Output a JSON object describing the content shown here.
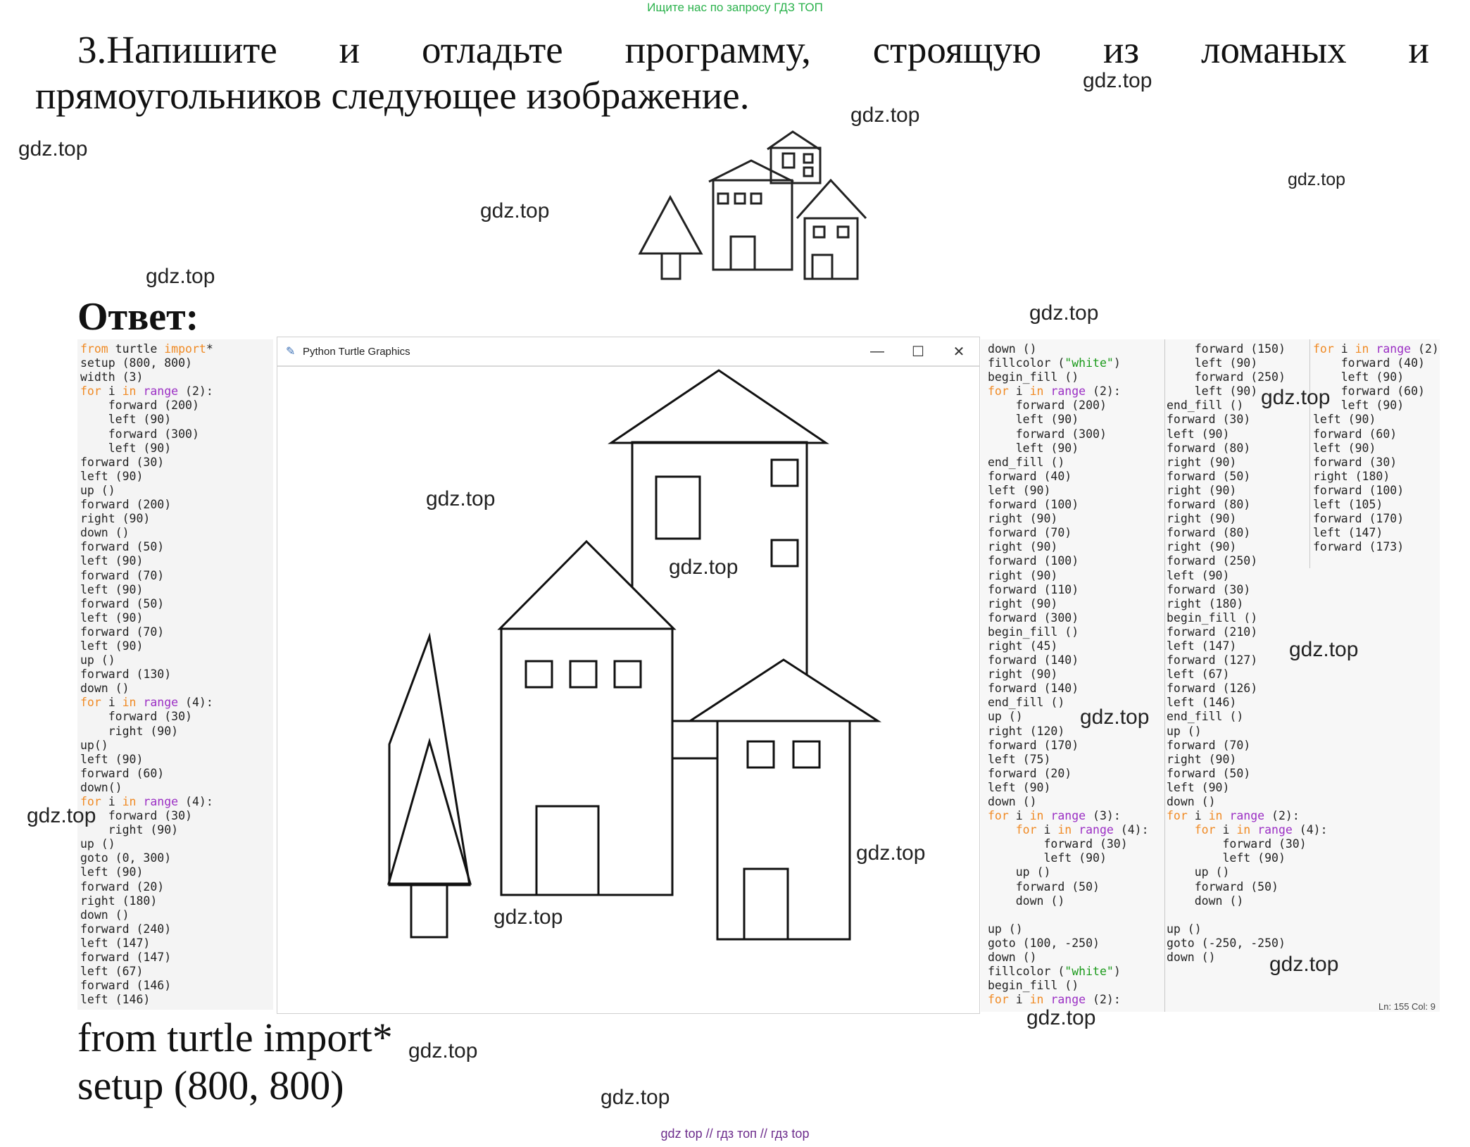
{
  "banner": "Ищите нас по запросу ГДЗ ТОП",
  "task": {
    "line1": [
      "3.Напишите",
      "и",
      "отладьте",
      "программу,",
      "строящую",
      "из",
      "ломаных",
      "и"
    ],
    "line2": "прямоугольников следующее изображение."
  },
  "answer_label": "Ответ:",
  "watermark": "gdz.top",
  "window": {
    "title": "Python Turtle Graphics",
    "minimize": "—",
    "maximize": "☐",
    "close": "✕"
  },
  "code_left": [
    "from turtle import*",
    "setup (800, 800)",
    "width (3)",
    "for i in range (2):",
    "    forward (200)",
    "    left (90)",
    "    forward (300)",
    "    left (90)",
    "forward (30)",
    "left (90)",
    "up ()",
    "forward (200)",
    "right (90)",
    "down ()",
    "forward (50)",
    "left (90)",
    "forward (70)",
    "left (90)",
    "forward (50)",
    "left (90)",
    "forward (70)",
    "left (90)",
    "up ()",
    "forward (130)",
    "down ()",
    "for i in range (4):",
    "    forward (30)",
    "    right (90)",
    "up()",
    "left (90)",
    "forward (60)",
    "down()",
    "for i in range (4):",
    "    forward (30)",
    "    right (90)",
    "up ()",
    "goto (0, 300)",
    "left (90)",
    "forward (20)",
    "right (180)",
    "down ()",
    "forward (240)",
    "left (147)",
    "forward (147)",
    "left (67)",
    "forward (146)",
    "left (146)"
  ],
  "code_right1": [
    "down ()",
    "fillcolor (\"white\")",
    "begin_fill ()",
    "for i in range (2):",
    "    forward (200)",
    "    left (90)",
    "    forward (300)",
    "    left (90)",
    "end_fill ()",
    "forward (40)",
    "left (90)",
    "forward (100)",
    "right (90)",
    "forward (70)",
    "right (90)",
    "forward (100)",
    "right (90)",
    "forward (110)",
    "right (90)",
    "forward (300)",
    "begin_fill ()",
    "right (45)",
    "forward (140)",
    "right (90)",
    "forward (140)",
    "end_fill ()",
    "up ()",
    "right (120)",
    "forward (170)",
    "left (75)",
    "forward (20)",
    "left (90)",
    "down ()",
    "for i in range (3):",
    "    for i in range (4):",
    "        forward (30)",
    "        left (90)",
    "    up ()",
    "    forward (50)",
    "    down ()",
    "",
    "up ()",
    "goto (100, -250)",
    "down ()",
    "fillcolor (\"white\")",
    "begin_fill ()",
    "for i in range (2):"
  ],
  "code_right2": [
    "    forward (150)",
    "    left (90)",
    "    forward (250)",
    "    left (90)",
    "end_fill ()",
    "forward (30)",
    "left (90)",
    "forward (80)",
    "right (90)",
    "forward (50)",
    "right (90)",
    "forward (80)",
    "right (90)",
    "forward (80)",
    "right (90)",
    "forward (250)",
    "left (90)",
    "forward (30)",
    "right (180)",
    "begin_fill ()",
    "forward (210)",
    "left (147)",
    "forward (127)",
    "left (67)",
    "forward (126)",
    "left (146)",
    "end_fill ()",
    "up ()",
    "forward (70)",
    "right (90)",
    "forward (50)",
    "left (90)",
    "down ()",
    "for i in range (2):",
    "    for i in range (4):",
    "        forward (30)",
    "        left (90)",
    "    up ()",
    "    forward (50)",
    "    down ()",
    "",
    "up ()",
    "goto (-250, -250)",
    "down ()"
  ],
  "code_right3": [
    "for i in range (2):",
    "    forward (40)",
    "    left (90)",
    "    forward (60)",
    "    left (90)",
    "left (90)",
    "forward (60)",
    "left (90)",
    "forward (30)",
    "right (180)",
    "forward (100)",
    "left (105)",
    "forward (170)",
    "left (147)",
    "forward (173)"
  ],
  "status_bar": "Ln: 155   Col: 9",
  "bottom_code": [
    "from turtle import*",
    "setup (800, 800)"
  ],
  "footer": "gdz top  //  гдз топ  //  гдз top"
}
